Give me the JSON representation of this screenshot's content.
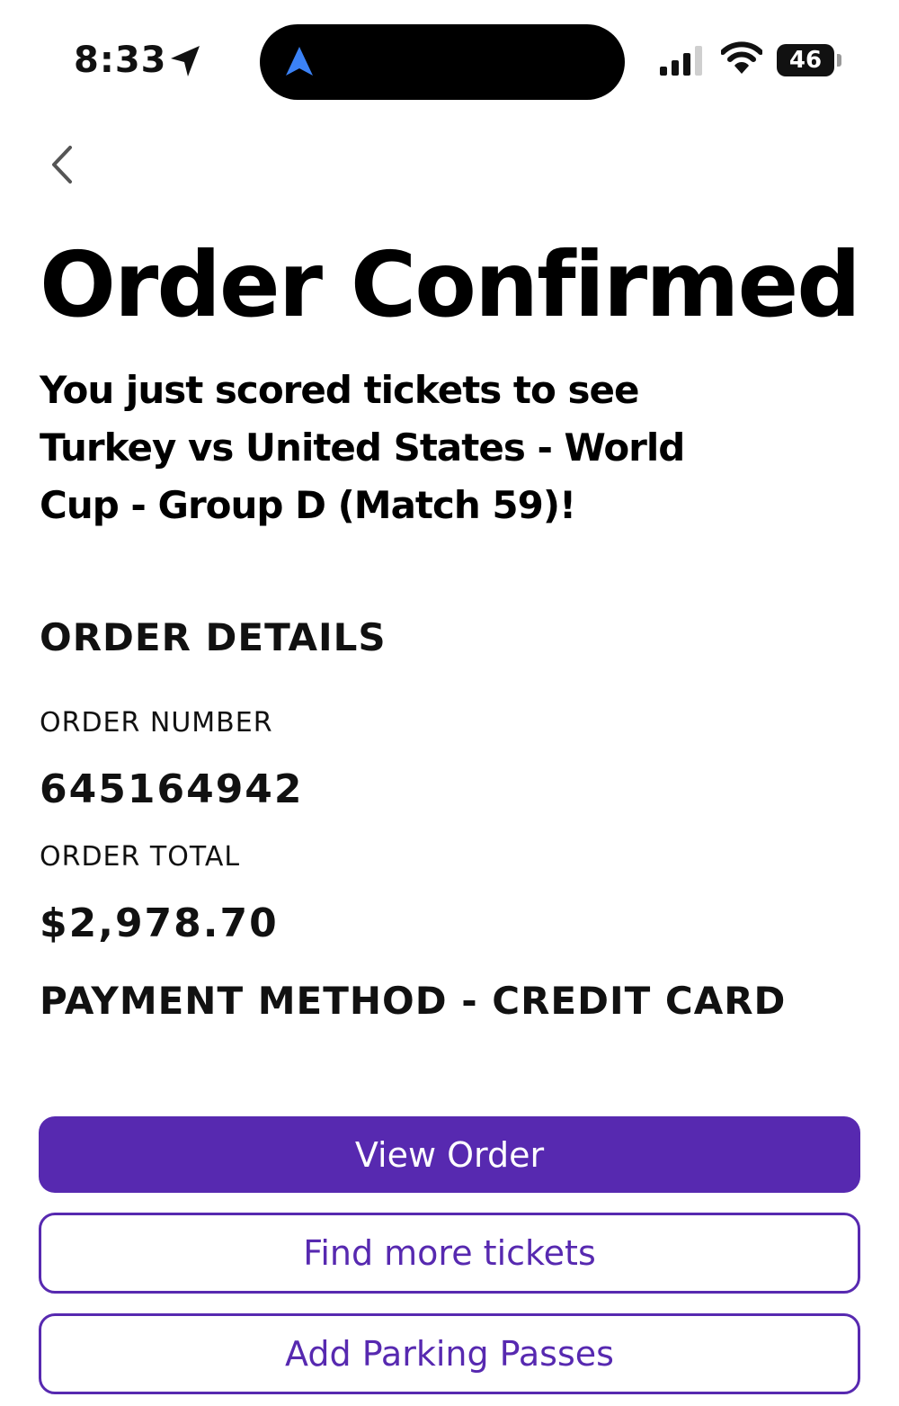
{
  "status_bar": {
    "time": "8:33",
    "battery": "46",
    "icons": [
      "location-arrow-icon",
      "navigation-icon",
      "signal-icon",
      "wifi-icon",
      "battery-icon"
    ]
  },
  "nav": {
    "back_icon": "chevron-left-icon"
  },
  "title": "Order Confirmed",
  "subtitle": "You just scored tickets to see Turkey vs United States - World Cup - Group D (Match 59)!",
  "order_details": {
    "heading": "ORDER DETAILS",
    "order_number_label": "ORDER NUMBER",
    "order_number": "645164942",
    "order_total_label": "ORDER TOTAL",
    "order_total": "$2,978.70",
    "payment_method": "PAYMENT METHOD - CREDIT CARD"
  },
  "buttons": {
    "view_order": "View Order",
    "find_more": "Find more tickets",
    "add_parking": "Add Parking Passes"
  },
  "colors": {
    "accent": "#5729b0",
    "island_nav": "#3b82f6",
    "text": "#111111"
  }
}
